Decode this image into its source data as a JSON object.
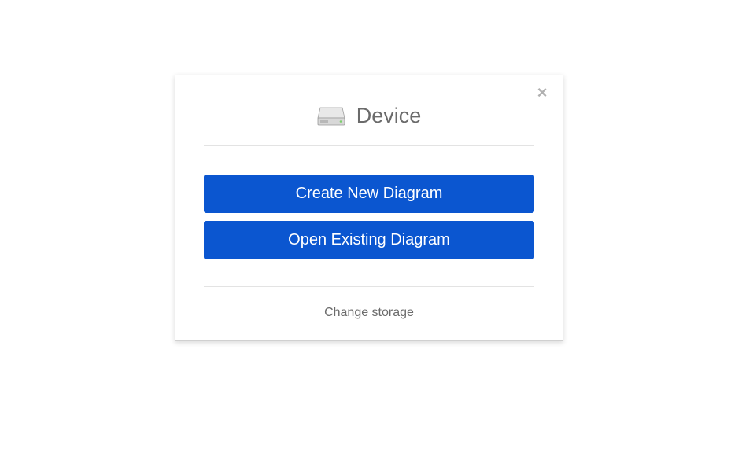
{
  "dialog": {
    "title": "Device",
    "buttons": {
      "create": "Create New Diagram",
      "open": "Open Existing Diagram"
    },
    "footer": {
      "change_storage": "Change storage"
    }
  }
}
